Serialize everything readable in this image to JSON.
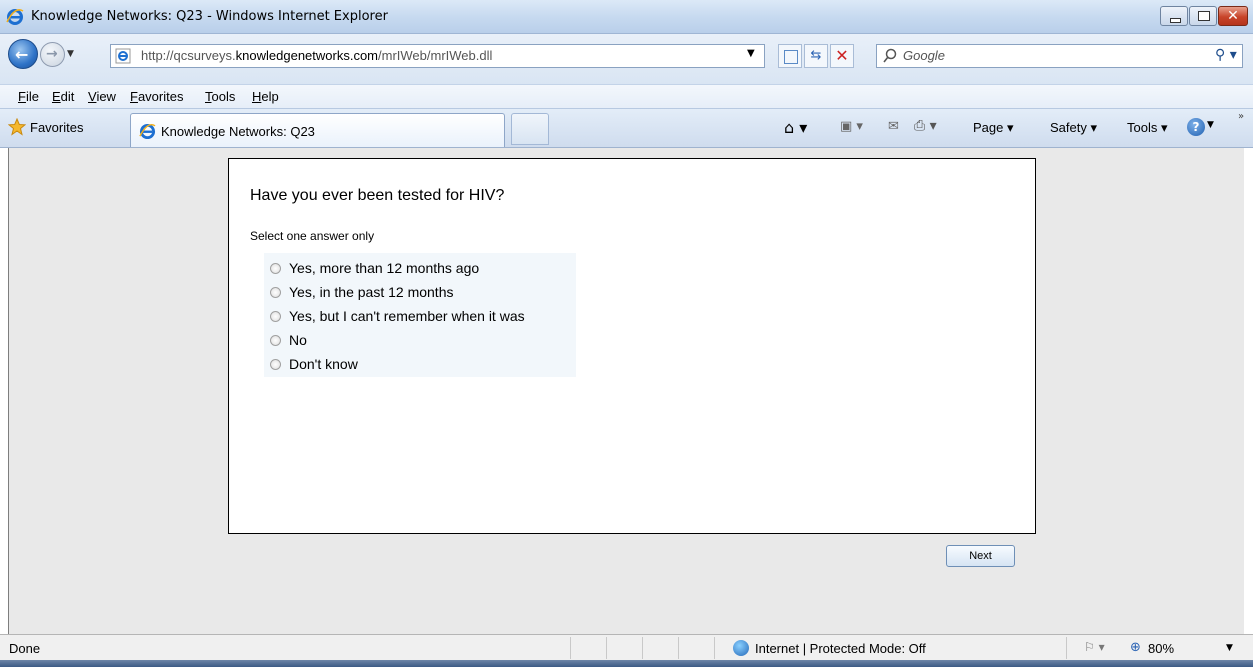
{
  "window": {
    "title": "Knowledge Networks: Q23 - Windows Internet Explorer"
  },
  "nav": {
    "address_prefix": "http://qcsurveys.",
    "address_domain": "knowledgenetworks.com",
    "address_path": "/mrIWeb/mrIWeb.dll",
    "search_placeholder": "Google"
  },
  "menu": {
    "items": [
      "File",
      "Edit",
      "View",
      "Favorites",
      "Tools",
      "Help"
    ]
  },
  "favbar": {
    "favorites_label": "Favorites",
    "tab_label": "Knowledge Networks: Q23",
    "commands": {
      "page": "Page ▾",
      "safety": "Safety ▾",
      "tools": "Tools ▾"
    }
  },
  "survey": {
    "question": "Have you ever been tested for HIV?",
    "instruction": "Select one answer only",
    "answers": [
      "Yes, more than 12 months ago",
      "Yes, in the past 12 months",
      "Yes, but I can't remember when it was",
      "No",
      "Don't know"
    ],
    "next_label": "Next"
  },
  "status": {
    "text": "Done",
    "zone": "Internet | Protected Mode: Off",
    "zoom": "80%"
  },
  "colors": {
    "accent": "#2f73c7",
    "content_bg": "#e9e9e9",
    "answers_bg": "#f2f7fb"
  }
}
